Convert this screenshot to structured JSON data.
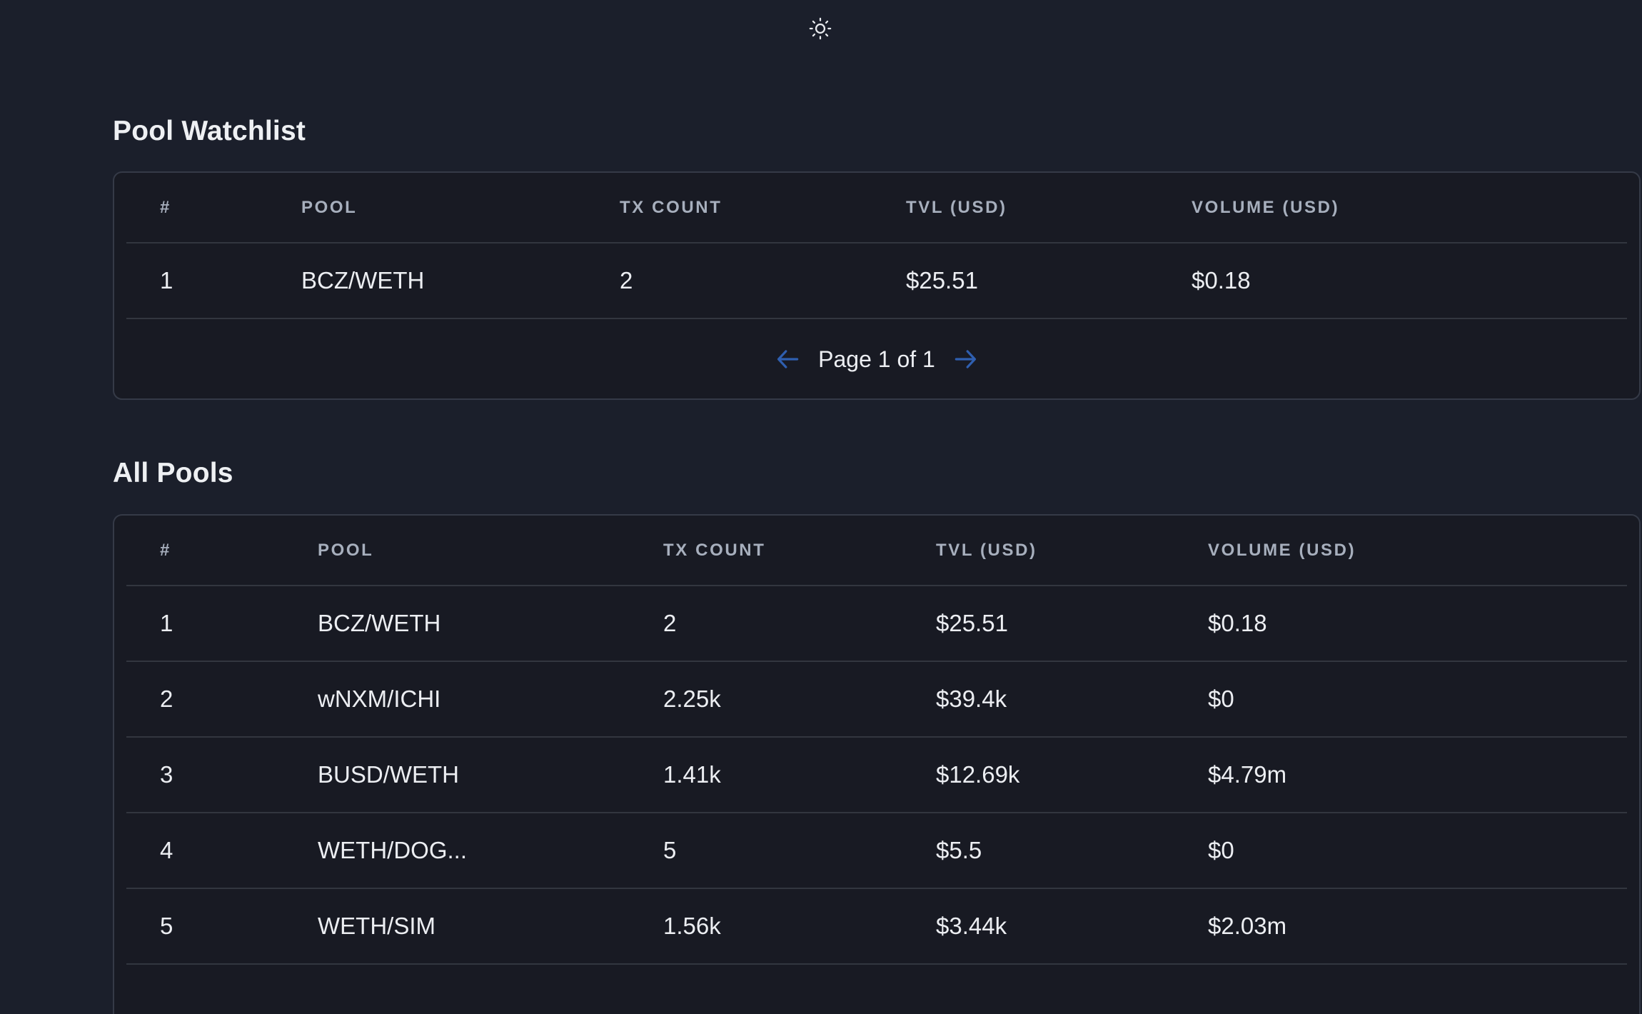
{
  "header": {
    "theme_icon": "sun-icon"
  },
  "watchlist": {
    "title": "Pool Watchlist",
    "columns": [
      "#",
      "POOL",
      "TX COUNT",
      "TVL (USD)",
      "VOLUME (USD)"
    ],
    "rows": [
      {
        "rank": "1",
        "pool": "BCZ/WETH",
        "tx_count": "2",
        "tvl": "$25.51",
        "volume": "$0.18"
      }
    ],
    "pagination": {
      "label": "Page 1 of 1",
      "prev_icon": "arrow-left-icon",
      "next_icon": "arrow-right-icon"
    }
  },
  "all_pools": {
    "title": "All Pools",
    "columns": [
      "#",
      "POOL",
      "TX COUNT",
      "TVL (USD)",
      "VOLUME (USD)"
    ],
    "rows": [
      {
        "rank": "1",
        "pool": "BCZ/WETH",
        "tx_count": "2",
        "tvl": "$25.51",
        "volume": "$0.18"
      },
      {
        "rank": "2",
        "pool": "wNXM/ICHI",
        "tx_count": "2.25k",
        "tvl": "$39.4k",
        "volume": "$0"
      },
      {
        "rank": "3",
        "pool": "BUSD/WETH",
        "tx_count": "1.41k",
        "tvl": "$12.69k",
        "volume": "$4.79m"
      },
      {
        "rank": "4",
        "pool": "WETH/DOG...",
        "tx_count": "5",
        "tvl": "$5.5",
        "volume": "$0"
      },
      {
        "rank": "5",
        "pool": "WETH/SIM",
        "tx_count": "1.56k",
        "tvl": "$3.44k",
        "volume": "$2.03m"
      }
    ]
  },
  "colors": {
    "background": "#1b1f2b",
    "card": "#181a23",
    "accent_arrow": "#2f5fb0"
  }
}
